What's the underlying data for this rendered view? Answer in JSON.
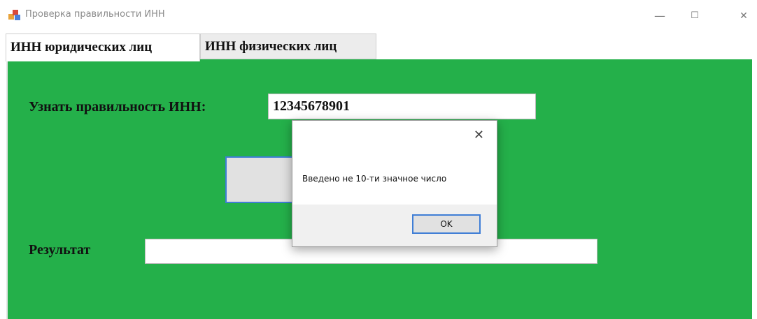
{
  "window": {
    "title": "Проверка правильности ИНН",
    "minimize_glyph": "—",
    "maximize_glyph": "☐",
    "close_glyph": "✕",
    "icon": "app-window-icon"
  },
  "tabs": [
    {
      "label": "ИНН юридических лиц",
      "active": true
    },
    {
      "label": "ИНН физических лиц",
      "active": false
    }
  ],
  "panel": {
    "background": "#24b04a",
    "inn_label": "Узнать правильность ИНН:",
    "inn_value": "12345678901",
    "check_button_label": "",
    "result_label": "Результат",
    "result_value": ""
  },
  "dialog": {
    "close_glyph": "✕",
    "message": "Введено не 10-ти значное число",
    "ok_label": "OK"
  }
}
